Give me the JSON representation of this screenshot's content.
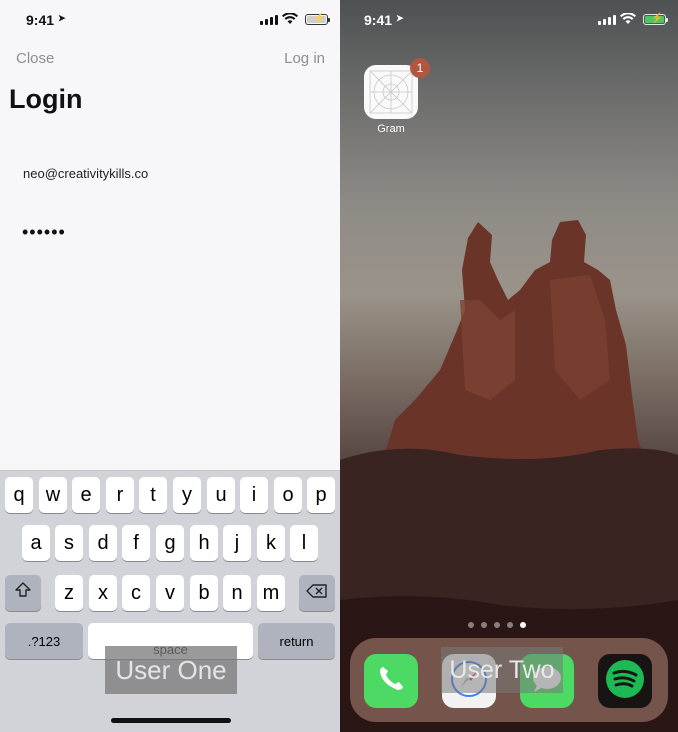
{
  "left_phone": {
    "status_bar": {
      "time": "9:41"
    },
    "nav": {
      "close_label": "Close",
      "login_label": "Log in"
    },
    "title": "Login",
    "form": {
      "email": "neo@creativitykills.co",
      "password": "••••••"
    },
    "keyboard": {
      "row1": [
        "q",
        "w",
        "e",
        "r",
        "t",
        "y",
        "u",
        "i",
        "o",
        "p"
      ],
      "row2": [
        "a",
        "s",
        "d",
        "f",
        "g",
        "h",
        "j",
        "k",
        "l"
      ],
      "row3": [
        "z",
        "x",
        "c",
        "v",
        "b",
        "n",
        "m"
      ],
      "numbers_label": ".?123",
      "space_label": "space",
      "return_label": "return",
      "shift_icon": "shift-icon",
      "delete_icon": "delete-icon"
    },
    "overlay_label": "User One"
  },
  "right_phone": {
    "status_bar": {
      "time": "9:41"
    },
    "apps": [
      {
        "label": "Gram",
        "badge": "1"
      }
    ],
    "page_dots": {
      "count": 5,
      "active": 5
    },
    "dock": [
      {
        "icon": "phone-icon",
        "color": "#4cd964"
      },
      {
        "icon": "safari-icon",
        "color": "#f2f2f2"
      },
      {
        "icon": "messages-icon",
        "color": "#4cd964"
      },
      {
        "icon": "spotify-icon",
        "color": "#1db954"
      }
    ],
    "overlay_label": "User Two"
  },
  "colors": {
    "battery_green": "#4cd964",
    "badge": "#b1573f",
    "keyboard_bg": "#d1d3d9"
  }
}
